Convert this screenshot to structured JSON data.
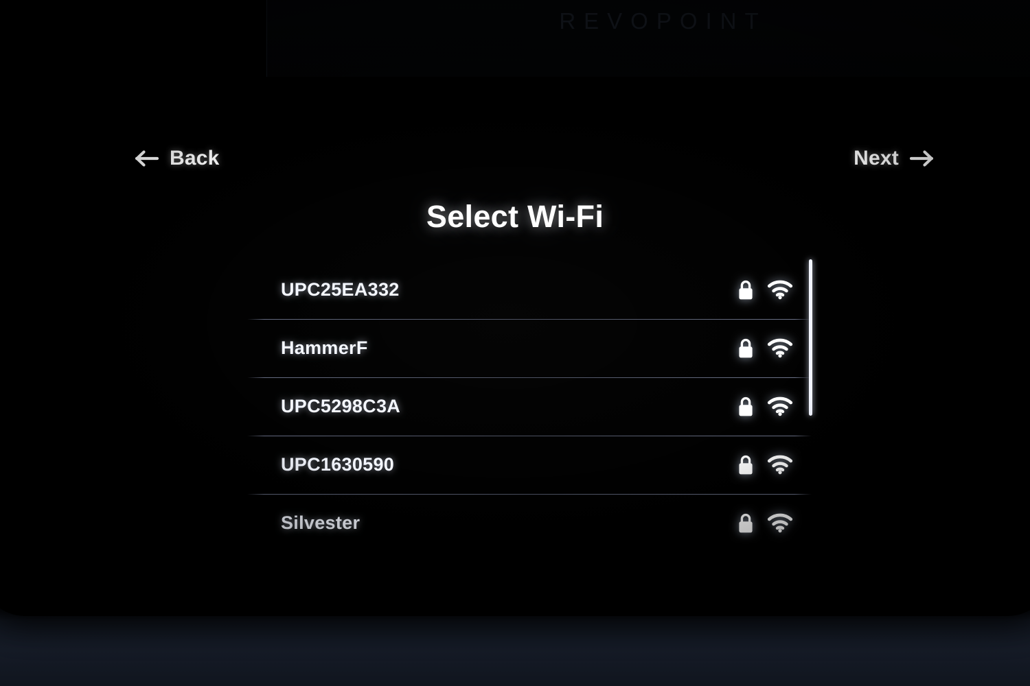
{
  "device": {
    "brand_wordmark": "REVOPOINT"
  },
  "nav": {
    "back_label": "Back",
    "back_icon": "arrow-left-icon",
    "next_label": "Next",
    "next_icon": "arrow-right-icon"
  },
  "header": {
    "title": "Select Wi-Fi"
  },
  "colors": {
    "screen_background": "#000000",
    "text_primary": "#ffffff",
    "divider": "#7e86a4",
    "scrollbar": "#f2f5ff",
    "brand_text": "#14181f"
  },
  "wifi_list": {
    "lock_icon": "lock-icon",
    "signal_icon": "wifi-icon",
    "networks": [
      {
        "ssid": "UPC25EA332",
        "secured": true,
        "signal": "wifi-full"
      },
      {
        "ssid": "HammerF",
        "secured": true,
        "signal": "wifi-full"
      },
      {
        "ssid": "UPC5298C3A",
        "secured": true,
        "signal": "wifi-full"
      },
      {
        "ssid": "UPC1630590",
        "secured": true,
        "signal": "wifi-full"
      },
      {
        "ssid": "Silvester",
        "secured": true,
        "signal": "wifi-full"
      }
    ]
  },
  "scrollbar": {
    "orientation": "vertical",
    "thumb_position_percent": 0,
    "thumb_size_percent": 57
  }
}
